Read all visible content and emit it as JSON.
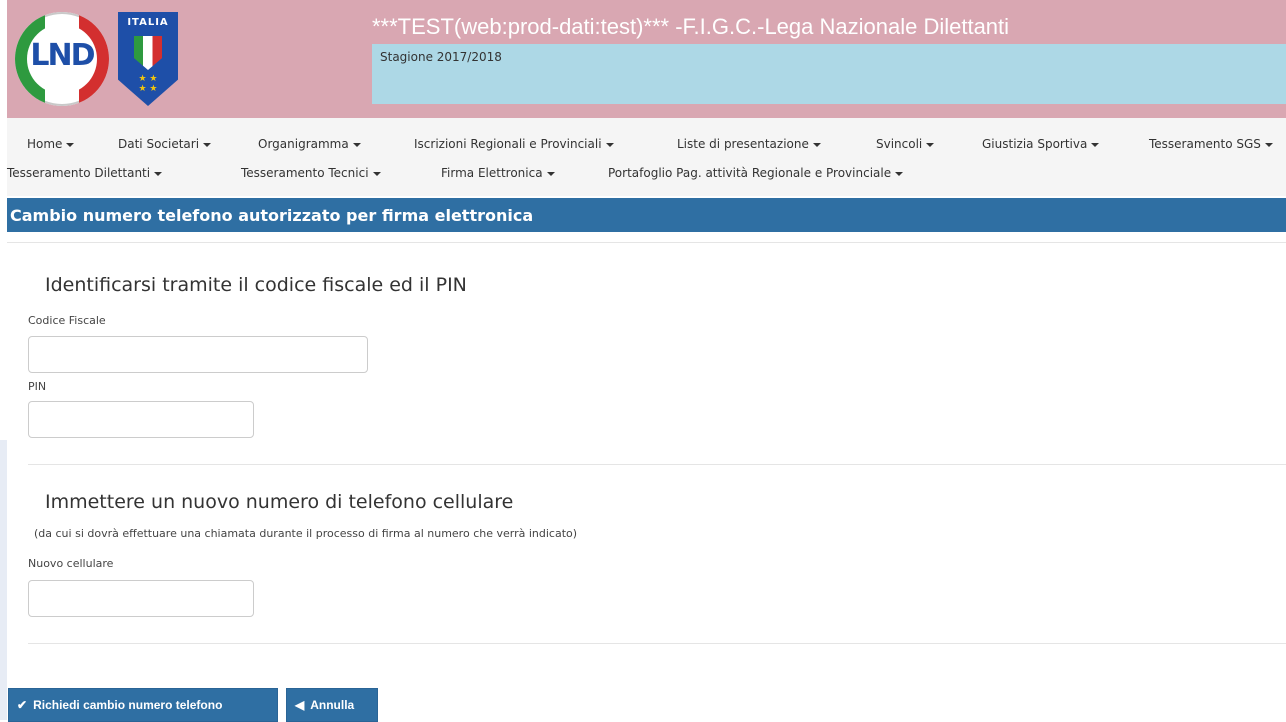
{
  "header": {
    "title": "***TEST(web:prod-dati:test)*** -F.I.G.C.-Lega Nazionale Dilettanti",
    "season": "Stagione 2017/2018",
    "logo_lnd_text": "LND",
    "logo_ita_text": "ITALIA"
  },
  "nav": {
    "row1": [
      {
        "label": "Home"
      },
      {
        "label": "Dati Societari"
      },
      {
        "label": "Organigramma"
      },
      {
        "label": "Iscrizioni Regionali e Provinciali"
      },
      {
        "label": "Liste di presentazione"
      },
      {
        "label": "Svincoli"
      },
      {
        "label": "Giustizia Sportiva"
      },
      {
        "label": "Tesseramento SGS"
      }
    ],
    "row2": [
      {
        "label": "Tesseramento Dilettanti"
      },
      {
        "label": "Tesseramento Tecnici"
      },
      {
        "label": "Firma Elettronica"
      },
      {
        "label": "Portafoglio Pag. attività Regionale e Provinciale"
      }
    ]
  },
  "page_title": "Cambio numero telefono autorizzato per firma elettronica",
  "form": {
    "identify_heading": "Identificarsi tramite il codice fiscale ed il PIN",
    "codice_fiscale_label": "Codice Fiscale",
    "codice_fiscale_value": "",
    "pin_label": "PIN",
    "pin_value": "",
    "new_phone_heading": "Immettere un nuovo numero di telefono cellulare",
    "new_phone_hint": "(da cui si dovrà effettuare una chiamata durante il processo di firma al numero che verrà indicato)",
    "new_phone_label": "Nuovo cellulare",
    "new_phone_value": ""
  },
  "buttons": {
    "submit_label": "Richiedi cambio numero telefono",
    "cancel_label": "Annulla"
  },
  "colors": {
    "header_bg": "#d9a7b2",
    "season_bg": "#add8e6",
    "primary": "#2f6fa3"
  }
}
